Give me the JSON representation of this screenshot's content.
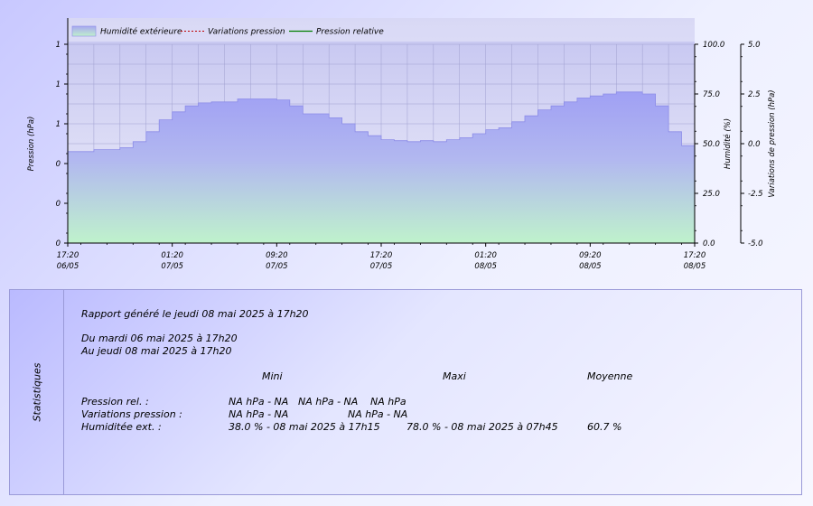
{
  "chart_data": {
    "type": "area",
    "legend": {
      "placement": "top",
      "entries": [
        {
          "label": "Humidité extérieure",
          "color": "#a8a8f0",
          "style": "area"
        },
        {
          "label": "Variations pression",
          "color": "#c00000",
          "style": "dashed"
        },
        {
          "label": "Pression relative",
          "color": "#008000",
          "style": "line"
        }
      ]
    },
    "x_ticks": [
      {
        "time": "17:20",
        "date": "06/05"
      },
      {
        "time": "01:20",
        "date": "07/05"
      },
      {
        "time": "09:20",
        "date": "07/05"
      },
      {
        "time": "17:20",
        "date": "07/05"
      },
      {
        "time": "01:20",
        "date": "08/05"
      },
      {
        "time": "09:20",
        "date": "08/05"
      },
      {
        "time": "17:20",
        "date": "08/05"
      }
    ],
    "left_axis": {
      "label": "Pression (hPa)",
      "tick_labels": [
        "0",
        "0",
        "0",
        "1",
        "1",
        "1"
      ]
    },
    "right_axis_1": {
      "label": "Humidité (%)",
      "tick_labels": [
        "0.0",
        "25.0",
        "50.0",
        "75.0",
        "100.0"
      ],
      "ylim": [
        0,
        100
      ]
    },
    "right_axis_2": {
      "label": "Variations de pression (hPa)",
      "tick_labels": [
        "-5.0",
        "-2.5",
        "0.0",
        "2.5",
        "5.0"
      ],
      "ylim": [
        -5,
        5
      ]
    },
    "grid": true,
    "series": [
      {
        "name": "Humidité extérieure",
        "axis": "right_axis_1",
        "x_hours": [
          0,
          1,
          2,
          3,
          4,
          5,
          6,
          7,
          8,
          9,
          10,
          11,
          12,
          13,
          14,
          15,
          16,
          17,
          18,
          19,
          20,
          21,
          22,
          23,
          24,
          25,
          26,
          27,
          28,
          29,
          30,
          31,
          32,
          33,
          34,
          35,
          36,
          37,
          38,
          39,
          40,
          41,
          42,
          43,
          44,
          45,
          46,
          47,
          48
        ],
        "values": [
          46,
          46,
          47,
          47,
          48,
          51,
          56,
          62,
          66,
          69,
          70.5,
          71,
          71,
          72.5,
          72.5,
          72.5,
          72,
          69,
          65,
          65,
          63,
          60,
          56,
          54,
          52,
          51.5,
          51,
          51.5,
          51,
          52,
          53,
          55,
          57,
          58,
          61,
          64,
          67,
          69,
          71,
          73,
          74,
          75,
          76,
          76,
          75,
          69,
          56,
          49,
          46
        ]
      }
    ]
  },
  "stats": {
    "title": "Statistiques",
    "generated": "Rapport généré le jeudi 08 mai 2025 à 17h20",
    "from": "Du mardi 06 mai 2025 à 17h20",
    "to": "Au jeudi 08 mai 2025 à 17h20",
    "headers": {
      "min": "Mini",
      "max": "Maxi",
      "avg": "Moyenne"
    },
    "rows": [
      {
        "label": "Pression rel. :",
        "min": "NA hPa - NA",
        "max": "NA hPa - NA",
        "avg": "NA hPa"
      },
      {
        "label": "Variations pression :",
        "min": "NA hPa - NA",
        "max": "NA hPa - NA",
        "avg": ""
      },
      {
        "label": "Humiditée ext. :",
        "min": "38.0 % - 08 mai 2025 à 17h15",
        "max": "78.0 % - 08 mai 2025 à 07h45",
        "avg": "60.7 %"
      }
    ]
  }
}
